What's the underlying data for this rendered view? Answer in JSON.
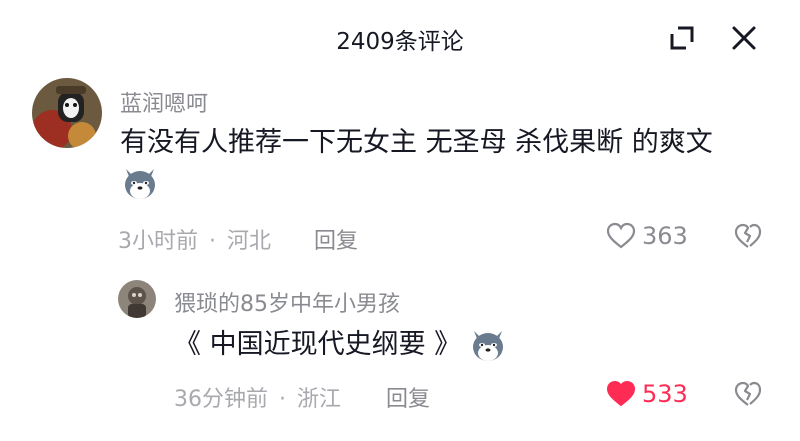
{
  "header": {
    "title": "2409条评论"
  },
  "comments": [
    {
      "username": "蓝润嗯呵",
      "content": "有没有人推荐一下无女主 无圣母 杀伐果断 的爽文",
      "time": "3小时前",
      "separator": "·",
      "location": "河北",
      "reply_label": "回复",
      "likes": "363",
      "liked": false,
      "emoji": "doge-wolf-emoji"
    },
    {
      "username": "猥琐的85岁中年小男孩",
      "content": "《 中国近现代史纲要 》",
      "time": "36分钟前",
      "separator": "·",
      "location": "浙江",
      "reply_label": "回复",
      "likes": "533",
      "liked": true,
      "emoji": "doge-wolf-emoji"
    }
  ],
  "colors": {
    "accent_like": "#fe2c55",
    "muted": "#8a8b91",
    "text": "#161823"
  },
  "icons": {
    "minimize": "minimize-icon",
    "close": "close-icon",
    "heart": "heart-icon",
    "dislike": "broken-heart-icon"
  }
}
